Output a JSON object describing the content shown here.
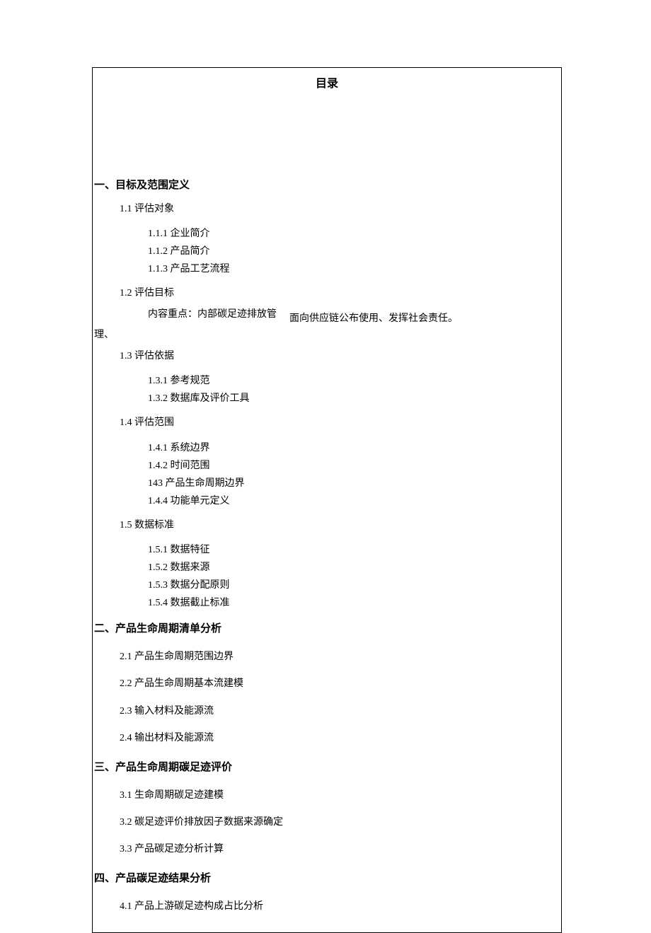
{
  "title": "目录",
  "sections": [
    {
      "heading": "一、目标及范围定义",
      "items": [
        {
          "label": "1.1 评估对象",
          "children": [
            "1.1.1 企业简介",
            "1.1.2 产品简介",
            "1.1.3 产品工艺流程"
          ]
        },
        {
          "label": "1.2 评估目标",
          "note_left": "内容重点：内部碳足迹排放管",
          "note_right": "面向供应链公布使用、发挥社会责任。",
          "note_suffix": "理、"
        },
        {
          "label": "1.3 评估依据",
          "children": [
            "1.3.1 参考规范",
            "1.3.2 数据库及评价工具"
          ]
        },
        {
          "label": "1.4 评估范围",
          "children": [
            "1.4.1 系统边界",
            "1.4.2 时间范围",
            "143 产品生命周期边界",
            "1.4.4 功能单元定义"
          ]
        },
        {
          "label": "1.5 数据标准",
          "children": [
            "1.5.1 数据特征",
            "1.5.2 数据来源",
            "1.5.3 数据分配原则",
            "1.5.4 数据截止标准"
          ]
        }
      ]
    },
    {
      "heading": "二、产品生命周期清单分析",
      "items": [
        {
          "label": "2.1 产品生命周期范围边界"
        },
        {
          "label": "2.2 产品生命周期基本流建模"
        },
        {
          "label": "2.3 输入材料及能源流"
        },
        {
          "label": "2.4 输出材料及能源流"
        }
      ]
    },
    {
      "heading": "三、产品生命周期碳足迹评价",
      "items": [
        {
          "label": "3.1 生命周期碳足迹建模"
        },
        {
          "label": "3.2 碳足迹评价排放因子数据来源确定"
        },
        {
          "label": "3.3 产品碳足迹分析计算"
        }
      ]
    },
    {
      "heading": "四、产品碳足迹结果分析",
      "items": [
        {
          "label": "4.1 产品上游碳足迹构成占比分析"
        }
      ]
    }
  ]
}
